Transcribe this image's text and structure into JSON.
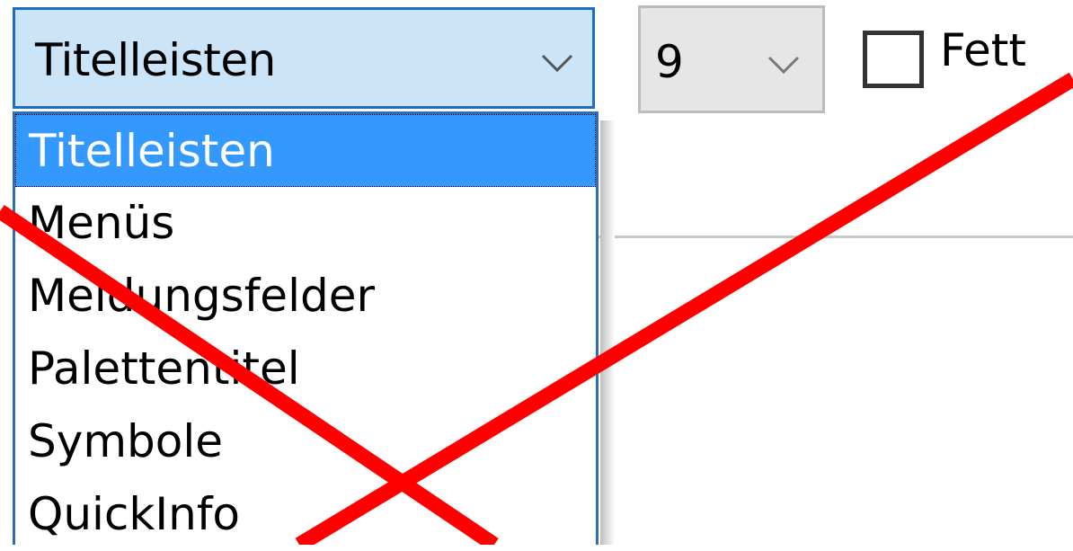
{
  "element_select": {
    "selected_value": "Titelleisten",
    "options": [
      "Titelleisten",
      "Menüs",
      "Meldungsfelder",
      "Palettentitel",
      "Symbole",
      "QuickInfo"
    ],
    "selected_index": 0
  },
  "size_select": {
    "selected_value": "9"
  },
  "bold_checkbox": {
    "label": "Fett",
    "checked": false
  },
  "overlay": {
    "cross_color": "#ff0000",
    "icon": "red-x-cross"
  },
  "colors": {
    "selection_background": "#3399ff",
    "combo_focus_background": "#cce4f7",
    "combo_focus_border": "#1f6fbf"
  }
}
